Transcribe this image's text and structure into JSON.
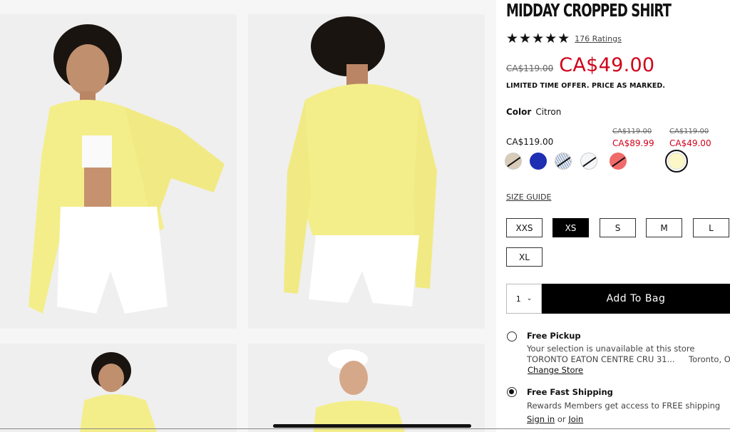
{
  "product": {
    "title": "MIDDAY CROPPED SHIRT",
    "stars": "★★★★★",
    "rating_count": "176 Ratings",
    "original_price": "CA$119.00",
    "sale_price": "CA$49.00",
    "offer_note": "LIMITED TIME OFFER. PRICE AS MARKED."
  },
  "color": {
    "label": "Color",
    "value": "Citron",
    "tiers": [
      {
        "price": "CA$119.00"
      },
      {
        "strike": "CA$119.00",
        "price": "CA$89.99"
      },
      {
        "strike": "CA$119.00",
        "price": "CA$49.00"
      }
    ],
    "swatches": [
      {
        "name": "beige",
        "color": "#d8ccb8",
        "unavailable": true
      },
      {
        "name": "blue",
        "color": "#1f2fb3",
        "unavailable": false
      },
      {
        "name": "stripe",
        "color": "#e4ebf3",
        "unavailable": true
      },
      {
        "name": "white",
        "color": "#f4f6f8",
        "unavailable": true
      },
      {
        "name": "coral",
        "color": "#f06a6a",
        "unavailable": true
      },
      {
        "name": "citron",
        "color": "#fbf7c6",
        "selected": true
      }
    ]
  },
  "size": {
    "guide_label": "SIZE GUIDE",
    "options": [
      "XXS",
      "XS",
      "S",
      "M",
      "L",
      "XL"
    ],
    "selected": "XS"
  },
  "cart": {
    "quantity": "1",
    "add_label": "Add To Bag"
  },
  "fulfillment": {
    "pickup_title": "Free Pickup",
    "pickup_note": "Your selection is unavailable at this store",
    "pickup_store": "TORONTO EATON CENTRE CRU 31...",
    "pickup_city": "Toronto, O",
    "change_store": "Change Store",
    "shipping_title": "Free Fast Shipping",
    "shipping_note": "Rewards Members get access to FREE shipping",
    "sign_in": "Sign in",
    "or": "or",
    "join": "Join"
  }
}
